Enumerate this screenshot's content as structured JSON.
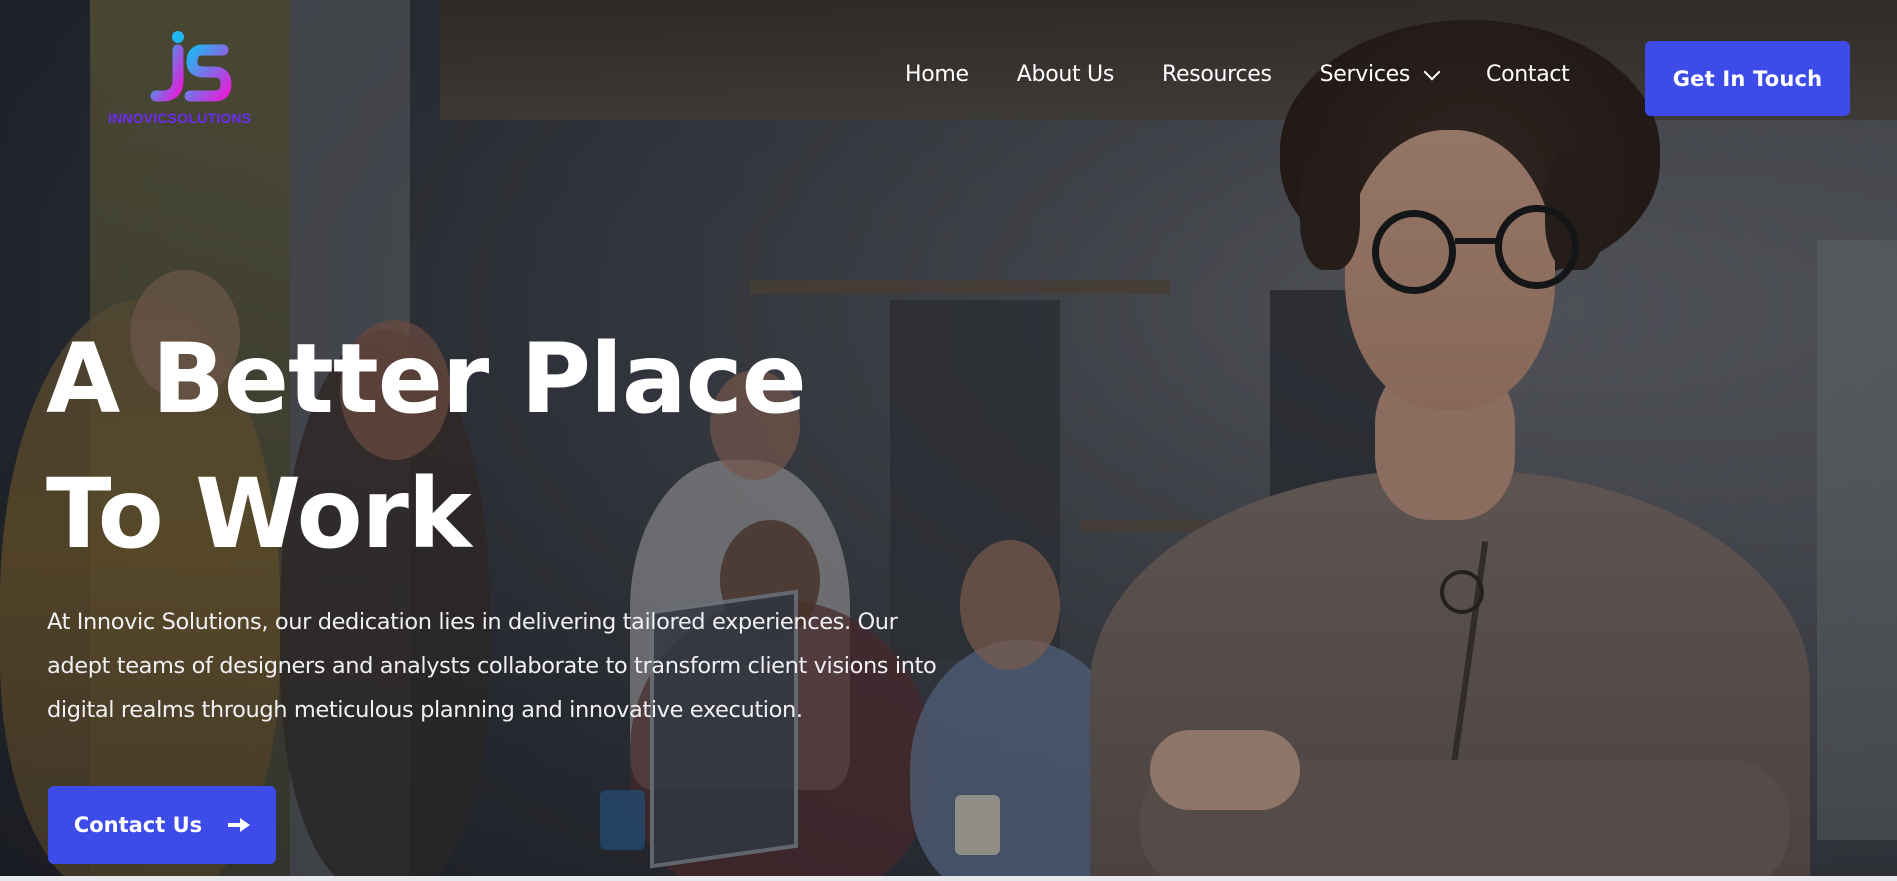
{
  "header": {
    "logo_text": "INNOVICSOLUTIONS",
    "nav": [
      "Home",
      "About Us",
      "Resources",
      "Services",
      "Contact"
    ],
    "cta_label": "Get In Touch"
  },
  "hero": {
    "headline_line1": "A Better Place",
    "headline_line2": "To Work",
    "description": "At Innovic Solutions, our dedication lies in delivering tailored experiences. Our adept teams of designers and analysts collaborate to transform client visions into digital realms through meticulous planning and innovative execution.",
    "button_label": "Contact Us",
    "button_icon": "arrow-right-icon"
  },
  "colors": {
    "accent": "#3d4ce8",
    "logo_gradient_start": "#1fb8f2",
    "logo_gradient_end": "#e21fd8",
    "logo_text": "#6a2cf0"
  }
}
